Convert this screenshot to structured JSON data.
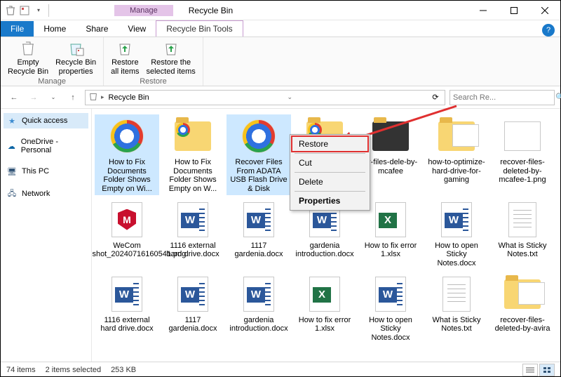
{
  "window": {
    "title": "Recycle Bin",
    "ctx_tab_header": "Manage"
  },
  "tabs": {
    "file": "File",
    "home": "Home",
    "share": "Share",
    "view": "View",
    "ctx": "Recycle Bin Tools"
  },
  "ribbon": {
    "manage": {
      "label": "Manage",
      "empty": "Empty\nRecycle Bin",
      "props": "Recycle Bin\nproperties"
    },
    "restore": {
      "label": "Restore",
      "all": "Restore\nall items",
      "sel": "Restore the\nselected items"
    }
  },
  "address": {
    "location": "Recycle Bin"
  },
  "search": {
    "placeholder": "Search Re..."
  },
  "nav": {
    "quick": "Quick access",
    "onedrive": "OneDrive - Personal",
    "thispc": "This PC",
    "network": "Network"
  },
  "ctxmenu": {
    "restore": "Restore",
    "cut": "Cut",
    "delete": "Delete",
    "properties": "Properties"
  },
  "items": [
    {
      "label": "How to Fix Documents Folder Shows Empty on Wi...",
      "icon": "chrome",
      "sel": true
    },
    {
      "label": "How to Fix Documents Folder Shows Empty on W...",
      "icon": "folder-chrome"
    },
    {
      "label": "Recover Files From ADATA USB Flash Drive & Disk Repair.html",
      "icon": "chrome",
      "sel": true
    },
    {
      "label": "",
      "icon": "folder-chrome-hidden"
    },
    {
      "label": "er-files-dele-by-mcafee",
      "icon": "folder-dark"
    },
    {
      "label": "how-to-optimize-hard-drive-for-gaming",
      "icon": "folder-preview"
    },
    {
      "label": "recover-files-deleted-by-mcafee-1.png",
      "icon": "img"
    },
    {
      "label": "WeCom Screenshot_20240716160541.png",
      "icon": "mcafee"
    },
    {
      "label": "1116 external hard drive.docx",
      "icon": "word"
    },
    {
      "label": "1117 gardenia.docx",
      "icon": "word"
    },
    {
      "label": "gardenia introduction.docx",
      "icon": "word"
    },
    {
      "label": "How to fix error 1.xlsx",
      "icon": "excel"
    },
    {
      "label": "How to open Sticky Notes.docx",
      "icon": "word"
    },
    {
      "label": "What is Sticky Notes.txt",
      "icon": "txt"
    },
    {
      "label": "1116 external hard drive.docx",
      "icon": "word"
    },
    {
      "label": "1117 gardenia.docx",
      "icon": "word"
    },
    {
      "label": "gardenia introduction.docx",
      "icon": "word"
    },
    {
      "label": "How to fix error 1.xlsx",
      "icon": "excel"
    },
    {
      "label": "How to open Sticky Notes.docx",
      "icon": "word"
    },
    {
      "label": "What is Sticky Notes.txt",
      "icon": "txt"
    },
    {
      "label": "recover-files-deleted-by-avira",
      "icon": "folder-preview"
    }
  ],
  "status": {
    "count": "74 items",
    "sel": "2 items selected",
    "size": "253 KB"
  }
}
